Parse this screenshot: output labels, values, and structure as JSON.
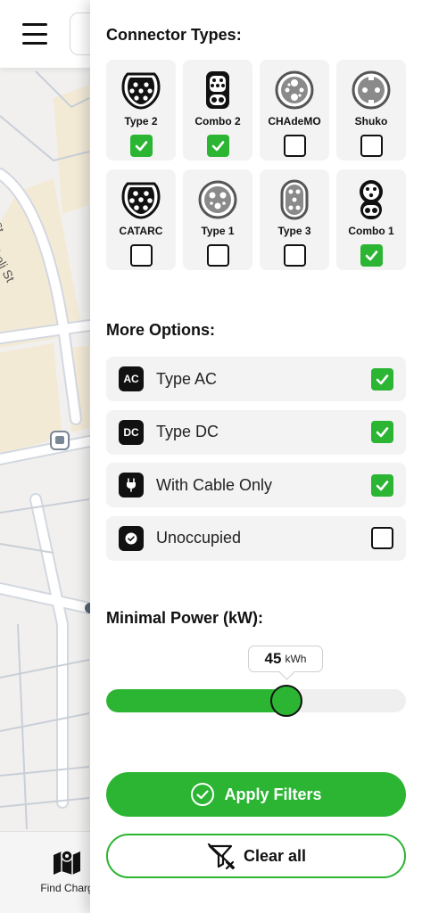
{
  "map": {
    "street_label": "Gamrekeli St",
    "street_fragment": "St"
  },
  "bottom_nav": {
    "find_label": "Find Charg"
  },
  "filters": {
    "connector_title": "Connector Types:",
    "connectors": [
      {
        "label": "Type 2",
        "icon": "type2-connector-icon",
        "selected": true
      },
      {
        "label": "Combo 2",
        "icon": "combo2-connector-icon",
        "selected": true
      },
      {
        "label": "CHAdeMO",
        "icon": "chademo-connector-icon",
        "selected": false
      },
      {
        "label": "Shuko",
        "icon": "shuko-connector-icon",
        "selected": false
      },
      {
        "label": "CATARC",
        "icon": "catarc-connector-icon",
        "selected": false
      },
      {
        "label": "Type 1",
        "icon": "type1-connector-icon",
        "selected": false
      },
      {
        "label": "Type 3",
        "icon": "type3-connector-icon",
        "selected": false
      },
      {
        "label": "Combo 1",
        "icon": "combo1-connector-icon",
        "selected": true
      }
    ],
    "options_title": "More Options:",
    "options": [
      {
        "label": "Type AC",
        "badge": "AC",
        "checked": true
      },
      {
        "label": "Type DC",
        "badge": "DC",
        "checked": true
      },
      {
        "label": "With Cable Only",
        "badge": "plug-icon",
        "checked": true
      },
      {
        "label": "Unoccupied",
        "badge": "check-circle-icon",
        "checked": false
      }
    ],
    "power_title": "Minimal Power (kW):",
    "power": {
      "value": 45,
      "unit": "kWh",
      "fraction": 0.6
    },
    "apply_label": "Apply Filters",
    "clear_label": "Clear all"
  },
  "colors": {
    "accent": "#2bb533",
    "dark": "#111111",
    "card": "#f3f3f3"
  }
}
